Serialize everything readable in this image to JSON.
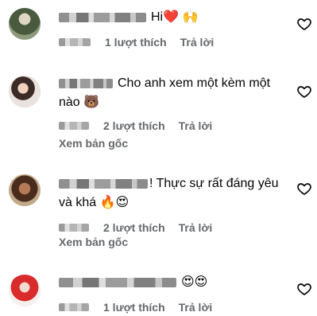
{
  "comments": [
    {
      "text": "Hi❤️ 🙌",
      "likes_label": "1 lượt thích",
      "reply_label": "Trả lời",
      "see_original": ""
    },
    {
      "text": "Cho anh xem một kèm một nào 🐻",
      "likes_label": "2 lượt thích",
      "reply_label": "Trả lời",
      "see_original": "Xem bản gốc"
    },
    {
      "text": "! Thực sự rất đáng yêu và khá 🔥😍",
      "likes_label": "2 lượt thích",
      "reply_label": "Trả lời",
      "see_original": "Xem bản gốc"
    },
    {
      "text": "😍😍",
      "likes_label": "1 lượt thích",
      "reply_label": "Trả lời",
      "see_original": ""
    }
  ],
  "icons": {
    "like": "heart-outline-icon"
  }
}
